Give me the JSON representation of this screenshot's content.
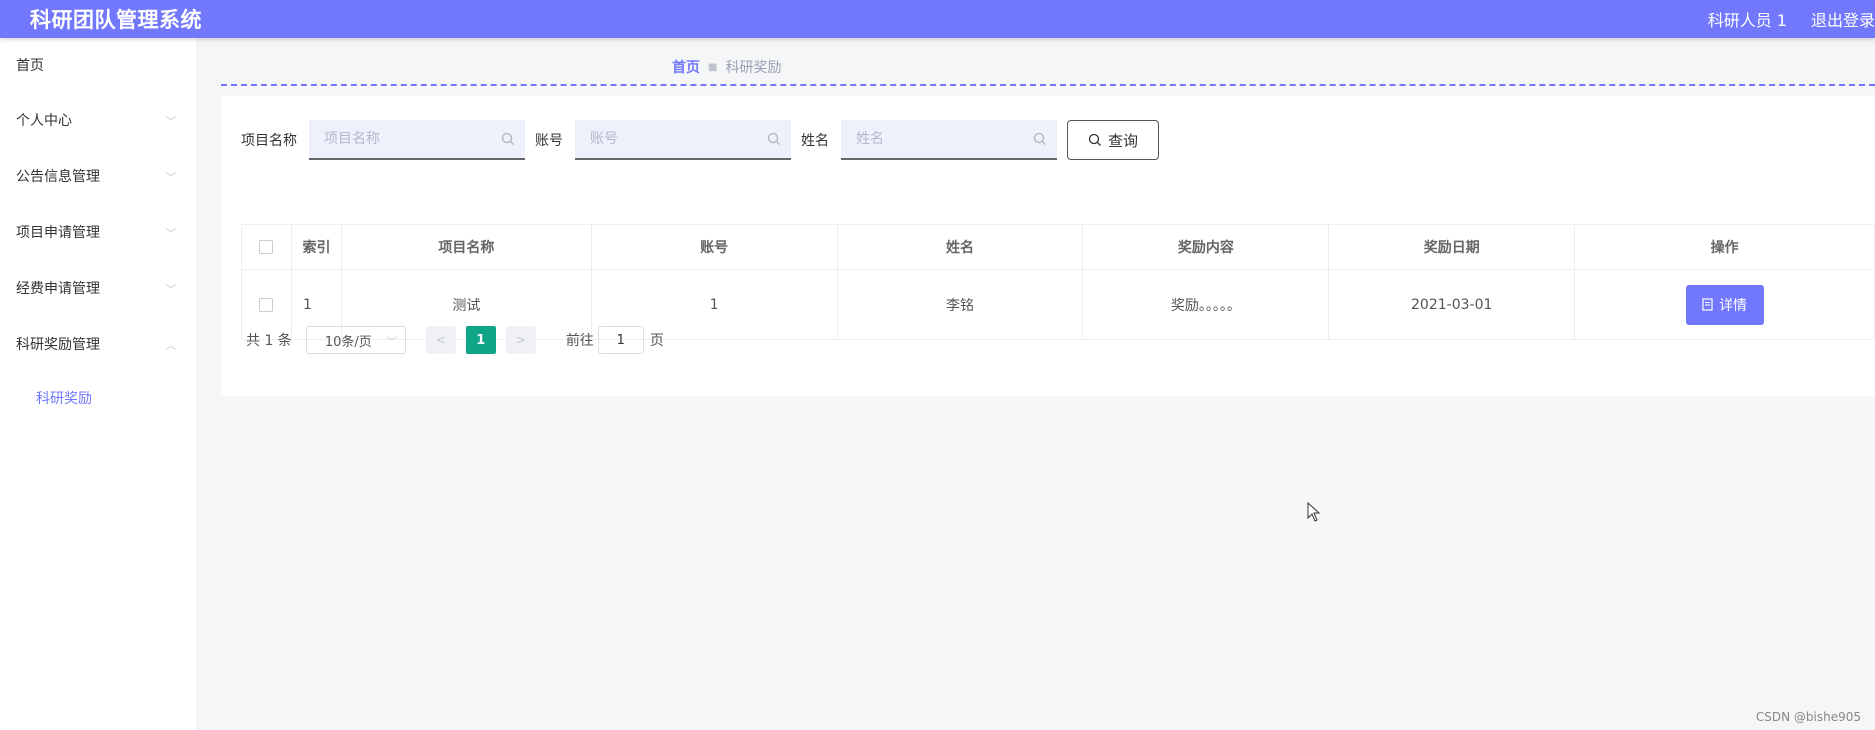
{
  "header": {
    "title": "科研团队管理系统",
    "user_label": "科研人员 1",
    "logout_label": "退出登录"
  },
  "sidebar": {
    "items": [
      {
        "label": "首页"
      },
      {
        "label": "个人中心"
      },
      {
        "label": "公告信息管理"
      },
      {
        "label": "项目申请管理"
      },
      {
        "label": "经费申请管理"
      },
      {
        "label": "科研奖励管理"
      }
    ],
    "active_sub": "科研奖励"
  },
  "breadcrumb": {
    "home": "首页",
    "current": "科研奖励"
  },
  "search": {
    "project_label": "项目名称",
    "project_placeholder": "项目名称",
    "account_label": "账号",
    "account_placeholder": "账号",
    "name_label": "姓名",
    "name_placeholder": "姓名",
    "query_label": "查询"
  },
  "table": {
    "headers": [
      "索引",
      "项目名称",
      "账号",
      "姓名",
      "奖励内容",
      "奖励日期",
      "操作"
    ],
    "rows": [
      {
        "index": "1",
        "project": "测试",
        "account": "1",
        "name": "李铭",
        "content": "奖励。。。。。",
        "date": "2021-03-01",
        "action": "详情"
      }
    ]
  },
  "pager": {
    "total": "共 1 条",
    "page_size": "10条/页",
    "current_page": "1",
    "goto_label": "前往",
    "goto_value": "1",
    "page_suffix": "页"
  },
  "watermark": "CSDN @bishe905",
  "colors": {
    "accent": "#7178fb",
    "pager_active": "#11a587"
  }
}
